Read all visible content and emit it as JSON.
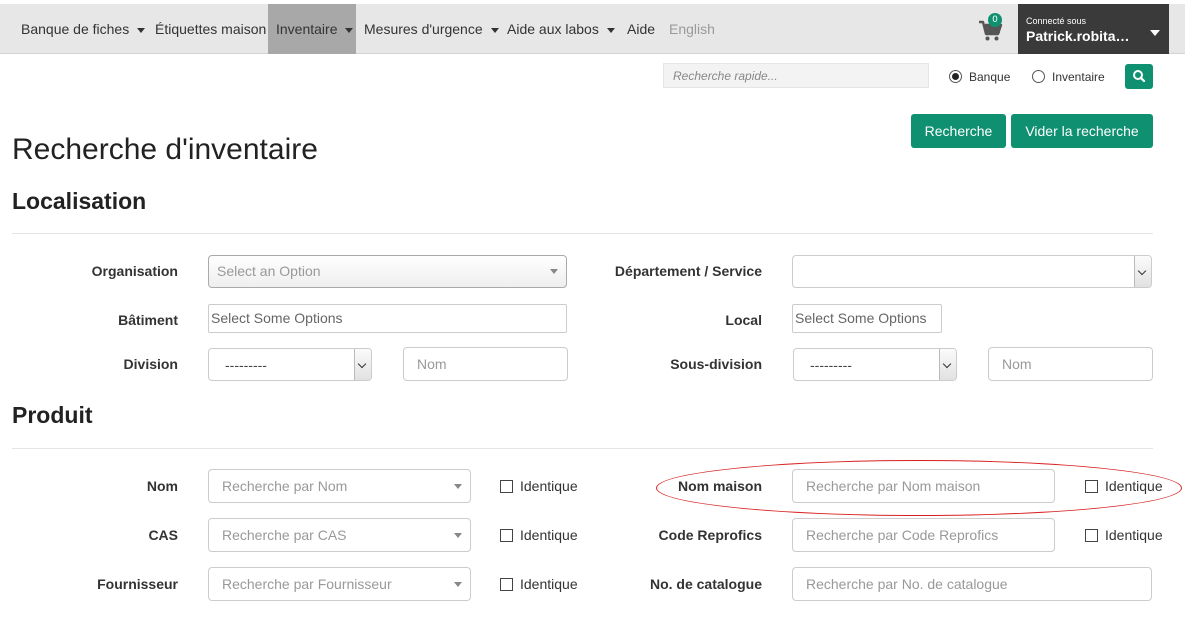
{
  "nav": {
    "items": [
      {
        "label": "Banque de fiches",
        "caret": true
      },
      {
        "label": "Étiquettes maison",
        "caret": false
      },
      {
        "label": "Inventaire",
        "caret": true,
        "active": true
      },
      {
        "label": "Mesures d'urgence",
        "caret": true
      },
      {
        "label": "Aide aux labos",
        "caret": true
      },
      {
        "label": "Aide",
        "caret": false
      },
      {
        "label": "English",
        "caret": false
      }
    ],
    "cart_count": "0",
    "user": {
      "connected_label": "Connecté sous",
      "name": "Patrick.robita…"
    }
  },
  "quick_search": {
    "placeholder": "Recherche rapide...",
    "options": [
      {
        "label": "Banque",
        "checked": true
      },
      {
        "label": "Inventaire",
        "checked": false
      }
    ]
  },
  "actions": {
    "search": "Recherche",
    "clear": "Vider la recherche"
  },
  "page_title": "Recherche d'inventaire",
  "localisation": {
    "title": "Localisation",
    "organisation": {
      "label": "Organisation",
      "placeholder": "Select an Option"
    },
    "departement": {
      "label": "Département / Service",
      "value": ""
    },
    "batiment": {
      "label": "Bâtiment",
      "placeholder": "Select Some Options"
    },
    "local": {
      "label": "Local",
      "placeholder": "Select Some Options"
    },
    "division": {
      "label": "Division",
      "value": "---------",
      "name_placeholder": "Nom"
    },
    "sous_division": {
      "label": "Sous-division",
      "value": "---------",
      "name_placeholder": "Nom"
    }
  },
  "produit": {
    "title": "Produit",
    "identique_label": "Identique",
    "nom": {
      "label": "Nom",
      "placeholder": "Recherche par Nom"
    },
    "cas": {
      "label": "CAS",
      "placeholder": "Recherche par CAS"
    },
    "fournisseur": {
      "label": "Fournisseur",
      "placeholder": "Recherche par Fournisseur"
    },
    "nom_maison": {
      "label": "Nom maison",
      "placeholder": "Recherche par Nom maison"
    },
    "code_reprofics": {
      "label": "Code Reprofics",
      "placeholder": "Recherche par Code Reprofics"
    },
    "no_catalogue": {
      "label": "No. de catalogue",
      "placeholder": "Recherche par No. de catalogue"
    }
  },
  "colors": {
    "accent": "#0f9070",
    "annotation": "#d81f1f"
  }
}
